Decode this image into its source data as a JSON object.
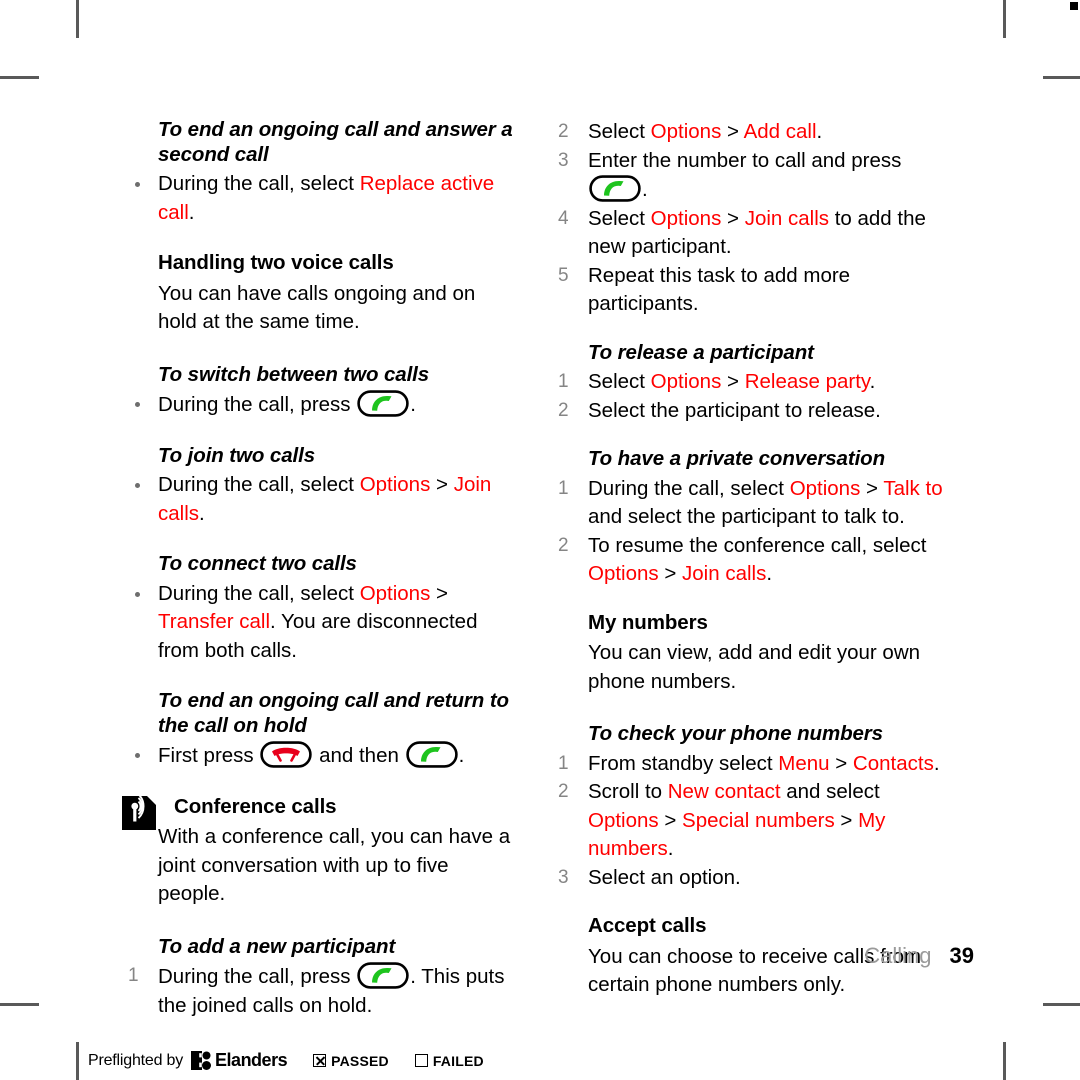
{
  "page": {
    "section_label": "Calling",
    "page_number": "39"
  },
  "left_column": [
    {
      "type": "heading-italic",
      "name": "heading-end-ongoing-answer-second",
      "text": "To end an ongoing call and answer a second call"
    },
    {
      "type": "bullet",
      "name": "bullet-replace-active-call",
      "parts": [
        {
          "text": "During the call, select ",
          "style": "plain"
        },
        {
          "text": "Replace active call",
          "style": "red"
        },
        {
          "text": ".",
          "style": "plain"
        }
      ]
    },
    {
      "type": "heading-bold",
      "name": "heading-handling-two-voice-calls",
      "text": "Handling two voice calls"
    },
    {
      "type": "paragraph",
      "name": "paragraph-handling-two-voice-calls",
      "text": "You can have calls ongoing and on hold at the same time."
    },
    {
      "type": "heading-italic",
      "name": "heading-switch-between-two-calls",
      "text": "To switch between two calls"
    },
    {
      "type": "bullet",
      "name": "bullet-switch-press-call-key",
      "parts": [
        {
          "text": "During the call, press ",
          "style": "plain"
        },
        {
          "text": "",
          "style": "key-call"
        },
        {
          "text": ".",
          "style": "plain"
        }
      ]
    },
    {
      "type": "heading-italic",
      "name": "heading-join-two-calls",
      "text": "To join two calls"
    },
    {
      "type": "bullet",
      "name": "bullet-join-calls",
      "parts": [
        {
          "text": "During the call, select ",
          "style": "plain"
        },
        {
          "text": "Options",
          "style": "red"
        },
        {
          "text": " > ",
          "style": "plain"
        },
        {
          "text": "Join calls",
          "style": "red"
        },
        {
          "text": ".",
          "style": "plain"
        }
      ]
    },
    {
      "type": "heading-italic",
      "name": "heading-connect-two-calls",
      "text": "To connect two calls"
    },
    {
      "type": "bullet",
      "name": "bullet-transfer-call",
      "parts": [
        {
          "text": "During the call, select ",
          "style": "plain"
        },
        {
          "text": "Options",
          "style": "red"
        },
        {
          "text": " > ",
          "style": "plain"
        },
        {
          "text": "Transfer call",
          "style": "red"
        },
        {
          "text": ". You are disconnected from both calls.",
          "style": "plain"
        }
      ]
    },
    {
      "type": "heading-italic",
      "name": "heading-end-ongoing-return-to-hold",
      "text": "To end an ongoing call and return to the call on hold"
    },
    {
      "type": "bullet",
      "name": "bullet-first-press-end-then-call",
      "parts": [
        {
          "text": "First press ",
          "style": "plain"
        },
        {
          "text": "",
          "style": "key-end"
        },
        {
          "text": " and then ",
          "style": "plain"
        },
        {
          "text": "",
          "style": "key-call"
        },
        {
          "text": ".",
          "style": "plain"
        }
      ]
    },
    {
      "type": "heading-bold-icon",
      "name": "heading-conference-calls",
      "text": "Conference calls",
      "icon": "broadcast-note-icon"
    },
    {
      "type": "paragraph",
      "name": "paragraph-conference-calls",
      "text": "With a conference call, you can have a joint conversation with up to five people."
    },
    {
      "type": "heading-italic",
      "name": "heading-add-new-participant",
      "text": "To add a new participant"
    },
    {
      "type": "numbered",
      "name": "step-add-participant-1",
      "num": "1",
      "parts": [
        {
          "text": "During the call, press ",
          "style": "plain"
        },
        {
          "text": "",
          "style": "key-call"
        },
        {
          "text": ". This puts the joined calls on hold.",
          "style": "plain"
        }
      ]
    }
  ],
  "right_column": [
    {
      "type": "numbered",
      "name": "step-add-participant-2",
      "num": "2",
      "parts": [
        {
          "text": "Select ",
          "style": "plain"
        },
        {
          "text": "Options",
          "style": "red"
        },
        {
          "text": " > ",
          "style": "plain"
        },
        {
          "text": "Add call",
          "style": "red"
        },
        {
          "text": ".",
          "style": "plain"
        }
      ]
    },
    {
      "type": "numbered",
      "name": "step-add-participant-3",
      "num": "3",
      "parts": [
        {
          "text": "Enter the number to call and press ",
          "style": "plain"
        },
        {
          "text": "",
          "style": "key-call"
        },
        {
          "text": ".",
          "style": "plain"
        }
      ]
    },
    {
      "type": "numbered",
      "name": "step-add-participant-4",
      "num": "4",
      "parts": [
        {
          "text": "Select ",
          "style": "plain"
        },
        {
          "text": "Options",
          "style": "red"
        },
        {
          "text": " > ",
          "style": "plain"
        },
        {
          "text": "Join calls",
          "style": "red"
        },
        {
          "text": " to add the new participant.",
          "style": "plain"
        }
      ]
    },
    {
      "type": "numbered",
      "name": "step-add-participant-5",
      "num": "5",
      "parts": [
        {
          "text": "Repeat this task to add more participants.",
          "style": "plain"
        }
      ]
    },
    {
      "type": "heading-italic",
      "name": "heading-release-participant",
      "text": "To release a participant"
    },
    {
      "type": "numbered",
      "name": "step-release-1",
      "num": "1",
      "parts": [
        {
          "text": "Select ",
          "style": "plain"
        },
        {
          "text": "Options",
          "style": "red"
        },
        {
          "text": " > ",
          "style": "plain"
        },
        {
          "text": "Release party",
          "style": "red"
        },
        {
          "text": ".",
          "style": "plain"
        }
      ]
    },
    {
      "type": "numbered",
      "name": "step-release-2",
      "num": "2",
      "parts": [
        {
          "text": "Select the participant to release.",
          "style": "plain"
        }
      ]
    },
    {
      "type": "heading-italic",
      "name": "heading-private-conversation",
      "text": "To have a private conversation"
    },
    {
      "type": "numbered",
      "name": "step-private-1",
      "num": "1",
      "parts": [
        {
          "text": "During the call, select ",
          "style": "plain"
        },
        {
          "text": "Options",
          "style": "red"
        },
        {
          "text": " > ",
          "style": "plain"
        },
        {
          "text": "Talk to",
          "style": "red"
        },
        {
          "text": " and select the participant to talk to.",
          "style": "plain"
        }
      ]
    },
    {
      "type": "numbered",
      "name": "step-private-2",
      "num": "2",
      "parts": [
        {
          "text": "To resume the conference call, select ",
          "style": "plain"
        },
        {
          "text": "Options",
          "style": "red"
        },
        {
          "text": " > ",
          "style": "plain"
        },
        {
          "text": "Join calls",
          "style": "red"
        },
        {
          "text": ".",
          "style": "plain"
        }
      ]
    },
    {
      "type": "heading-bold",
      "name": "heading-my-numbers",
      "text": "My numbers"
    },
    {
      "type": "paragraph",
      "name": "paragraph-my-numbers",
      "text": "You can view, add and edit your own phone numbers."
    },
    {
      "type": "heading-italic",
      "name": "heading-check-phone-numbers",
      "text": "To check your phone numbers"
    },
    {
      "type": "numbered",
      "name": "step-check-numbers-1",
      "num": "1",
      "parts": [
        {
          "text": "From standby select ",
          "style": "plain"
        },
        {
          "text": "Menu",
          "style": "red"
        },
        {
          "text": " > ",
          "style": "plain"
        },
        {
          "text": "Contacts",
          "style": "red"
        },
        {
          "text": ".",
          "style": "plain"
        }
      ]
    },
    {
      "type": "numbered",
      "name": "step-check-numbers-2",
      "num": "2",
      "parts": [
        {
          "text": "Scroll to ",
          "style": "plain"
        },
        {
          "text": "New contact",
          "style": "red"
        },
        {
          "text": " and select ",
          "style": "plain"
        },
        {
          "text": "Options",
          "style": "red"
        },
        {
          "text": " > ",
          "style": "plain"
        },
        {
          "text": "Special numbers",
          "style": "red"
        },
        {
          "text": " > ",
          "style": "plain"
        },
        {
          "text": "My numbers",
          "style": "red"
        },
        {
          "text": ".",
          "style": "plain"
        }
      ]
    },
    {
      "type": "numbered",
      "name": "step-check-numbers-3",
      "num": "3",
      "parts": [
        {
          "text": "Select an option.",
          "style": "plain"
        }
      ]
    },
    {
      "type": "heading-bold",
      "name": "heading-accept-calls",
      "text": "Accept calls"
    },
    {
      "type": "paragraph",
      "name": "paragraph-accept-calls",
      "text": "You can choose to receive calls from certain phone numbers only."
    }
  ],
  "preflight": {
    "text": "Preflighted by",
    "brand": "Elanders",
    "passed_label": "PASSED",
    "failed_label": "FAILED",
    "passed_checked": true,
    "failed_checked": false
  },
  "colors": {
    "ui_term_red": "#ff0000",
    "call_key_green": "#1ec41e",
    "end_key_red": "#e8001c",
    "list_number_gray": "#858585",
    "section_label_gray": "#9a9a9a",
    "crop_mark_gray": "#595959"
  }
}
